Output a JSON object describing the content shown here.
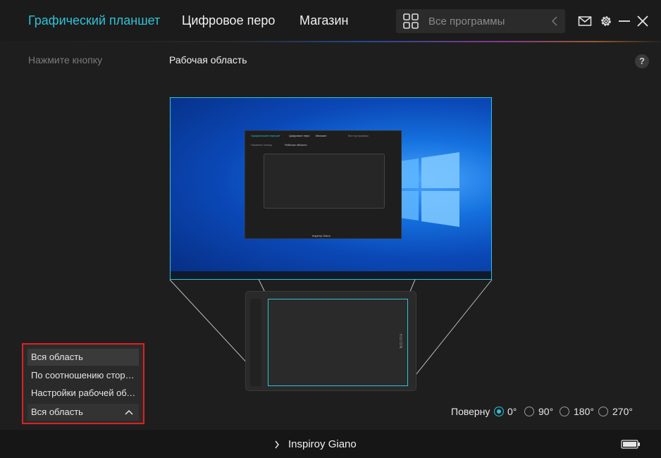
{
  "tabs": [
    {
      "label": "Графический планшет",
      "active": true
    },
    {
      "label": "Цифровое перо",
      "active": false
    },
    {
      "label": "Магазин",
      "active": false
    }
  ],
  "search": {
    "placeholder": "Все программы",
    "icon": "grid-icon"
  },
  "window_icons": [
    "mail-icon",
    "gear-icon",
    "minimize-icon",
    "close-icon"
  ],
  "subheader": {
    "left_label": "Нажмите кнопку",
    "active_label": "Рабочая область",
    "help": "?"
  },
  "mapping_dropdown": {
    "options": [
      "Вся область",
      "По соотношению сторон экрана",
      "Настройки рабочей области"
    ],
    "highlighted_index": 0,
    "selected": "Вся область"
  },
  "rotation": {
    "label": "Поверну",
    "options": [
      "0°",
      "90°",
      "180°",
      "270°"
    ],
    "selected": "0°"
  },
  "footer": {
    "device_name": "Inspiroy Giano",
    "battery": "battery-icon"
  },
  "mini_preview": {
    "tabs": [
      "Графический планшет",
      "Цифровое перо",
      "Магазин"
    ],
    "search_placeholder": "Все программы",
    "left_label": "Нажмите кнопку",
    "active_label": "Рабочая область",
    "device_name": "Inspiroy Giano"
  },
  "brand_text": "HUION",
  "colors": {
    "accent": "#2fc2d6",
    "highlight_border": "#e02020",
    "background": "#1e1e1e"
  }
}
